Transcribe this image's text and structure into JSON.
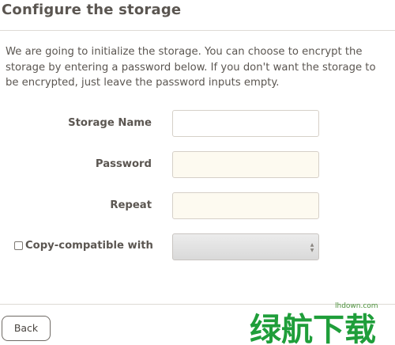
{
  "header": {
    "title": "Configure the storage"
  },
  "description": "We are going to initialize the storage. You can choose to encrypt the storage by entering a password below. If you don't want the storage to be encrypted, just leave the password inputs empty.",
  "form": {
    "storage_name": {
      "label": "Storage Name",
      "value": ""
    },
    "password": {
      "label": "Password",
      "value": ""
    },
    "repeat": {
      "label": "Repeat",
      "value": ""
    },
    "copy_compatible": {
      "label": "Copy-compatible with",
      "checked": false,
      "selected": ""
    }
  },
  "footer": {
    "back_label": "Back"
  },
  "watermark": {
    "site": "lhdown.com",
    "text": "绿航下载"
  },
  "colors": {
    "text": "#5b5651",
    "password_bg": "#fdfaf0",
    "border": "#d6d0c8",
    "watermark_green": "#1f9e3a"
  }
}
